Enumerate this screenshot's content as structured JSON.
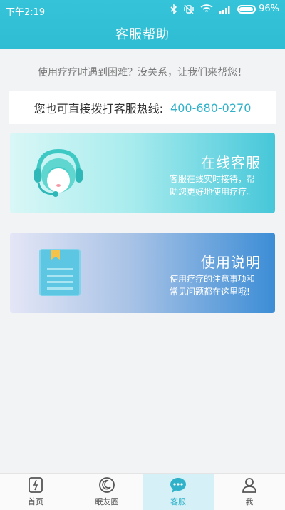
{
  "status_bar": {
    "time": "下午2:19",
    "battery": "96%"
  },
  "header": {
    "title": "客服帮助"
  },
  "tip": "使用疗疗时遇到困难？没关系，让我们来帮您！",
  "hotline": {
    "label": "您也可直接拨打客服热线:",
    "number": "400-680-0270"
  },
  "cards": [
    {
      "title": "在线客服",
      "desc": "客服在线实时接待，帮助您更好地使用疗疗。",
      "icon": "headset-agent-icon"
    },
    {
      "title": "使用说明",
      "desc": "使用疗疗的注意事项和常见问题都在这里哦!",
      "icon": "document-icon"
    }
  ],
  "bottom_nav": {
    "active_index": 2,
    "items": [
      {
        "label": "首页",
        "icon": "home-icon"
      },
      {
        "label": "眠友圈",
        "icon": "moon-icon"
      },
      {
        "label": "客服",
        "icon": "chat-icon"
      },
      {
        "label": "我",
        "icon": "user-icon"
      }
    ]
  },
  "colors": {
    "brand": "#2fbdd3",
    "hotline_number": "#2fb2c9",
    "active_tab_bg": "#d6f0f7"
  }
}
